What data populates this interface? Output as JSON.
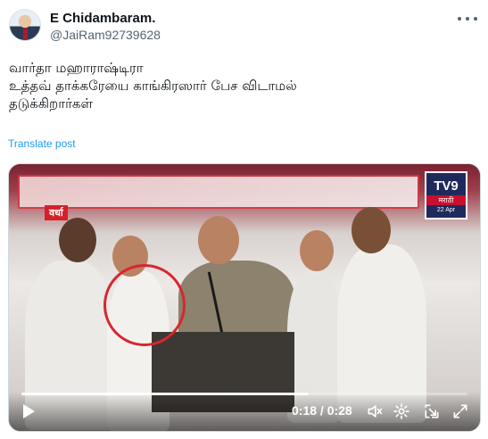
{
  "author": {
    "display_name": "E Chidambaram.",
    "handle": "@JaiRam92739628"
  },
  "post": {
    "lines": [
      "வார்தா மஹாராஷ்டிரா",
      "உத்தவ் தாக்கரேயை காங்கிரஸார் பேச விடாமல்",
      "தடுக்கிறார்கள்"
    ],
    "translate_label": "Translate post"
  },
  "video": {
    "overlay_logo": "TV9",
    "overlay_logo_sub": "मराठी",
    "overlay_date": "22 Apr",
    "overlay_tag": "वर्धा",
    "time_display": "0:18 / 0:28",
    "progress": 0.643,
    "highlight_color": "#d8262e"
  },
  "icons": {
    "more": "more-horizontal-icon",
    "play": "play-icon",
    "volume": "volume-icon",
    "settings": "settings-gear-icon",
    "pip": "picture-in-picture-icon",
    "fullscreen": "fullscreen-icon"
  },
  "colors": {
    "link": "#1d9bf0",
    "text": "#0f1419",
    "secondary": "#536471"
  }
}
